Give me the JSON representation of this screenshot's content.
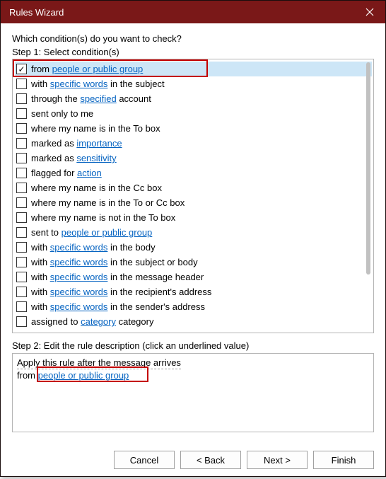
{
  "window": {
    "title": "Rules Wizard"
  },
  "prompt": "Which condition(s) do you want to check?",
  "step1_label": "Step 1: Select condition(s)",
  "conditions": [
    {
      "checked": true,
      "selected": true,
      "pre": "from ",
      "link": "people or public group",
      "post": ""
    },
    {
      "checked": false,
      "selected": false,
      "pre": "with ",
      "link": "specific words",
      "post": " in the subject"
    },
    {
      "checked": false,
      "selected": false,
      "pre": "through the ",
      "link": "specified",
      "post": " account"
    },
    {
      "checked": false,
      "selected": false,
      "pre": "sent only to me",
      "link": "",
      "post": ""
    },
    {
      "checked": false,
      "selected": false,
      "pre": "where my name is in the To box",
      "link": "",
      "post": ""
    },
    {
      "checked": false,
      "selected": false,
      "pre": "marked as ",
      "link": "importance",
      "post": ""
    },
    {
      "checked": false,
      "selected": false,
      "pre": "marked as ",
      "link": "sensitivity",
      "post": ""
    },
    {
      "checked": false,
      "selected": false,
      "pre": "flagged for ",
      "link": "action",
      "post": ""
    },
    {
      "checked": false,
      "selected": false,
      "pre": "where my name is in the Cc box",
      "link": "",
      "post": ""
    },
    {
      "checked": false,
      "selected": false,
      "pre": "where my name is in the To or Cc box",
      "link": "",
      "post": ""
    },
    {
      "checked": false,
      "selected": false,
      "pre": "where my name is not in the To box",
      "link": "",
      "post": ""
    },
    {
      "checked": false,
      "selected": false,
      "pre": "sent to ",
      "link": "people or public group",
      "post": ""
    },
    {
      "checked": false,
      "selected": false,
      "pre": "with ",
      "link": "specific words",
      "post": " in the body"
    },
    {
      "checked": false,
      "selected": false,
      "pre": "with ",
      "link": "specific words",
      "post": " in the subject or body"
    },
    {
      "checked": false,
      "selected": false,
      "pre": "with ",
      "link": "specific words",
      "post": " in the message header"
    },
    {
      "checked": false,
      "selected": false,
      "pre": "with ",
      "link": "specific words",
      "post": " in the recipient's address"
    },
    {
      "checked": false,
      "selected": false,
      "pre": "with ",
      "link": "specific words",
      "post": " in the sender's address"
    },
    {
      "checked": false,
      "selected": false,
      "pre": "assigned to ",
      "link": "category",
      "post": " category"
    }
  ],
  "step2_label": "Step 2: Edit the rule description (click an underlined value)",
  "description": {
    "line1": "Apply this rule after the message arrives",
    "line2_pre": "from ",
    "line2_link": "people or public group"
  },
  "buttons": {
    "cancel": "Cancel",
    "back": "< Back",
    "next": "Next >",
    "finish": "Finish"
  }
}
